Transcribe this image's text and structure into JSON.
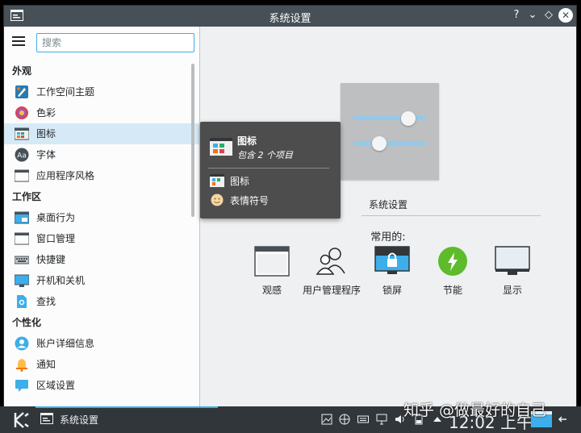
{
  "window": {
    "title": "系统设置"
  },
  "titlebar": {
    "help": "?",
    "minimize": "⌄",
    "keep_above": "◇",
    "close": "✕"
  },
  "search": {
    "placeholder": "搜索",
    "value": ""
  },
  "sidebar": {
    "sections": [
      {
        "title": "外观",
        "items": [
          {
            "label": "工作空间主题",
            "icon": "workspace-theme-icon"
          },
          {
            "label": "色彩",
            "icon": "colors-icon"
          },
          {
            "label": "图标",
            "icon": "icons-icon",
            "selected": true
          },
          {
            "label": "字体",
            "icon": "fonts-icon"
          },
          {
            "label": "应用程序风格",
            "icon": "app-style-icon"
          }
        ]
      },
      {
        "title": "工作区",
        "items": [
          {
            "label": "桌面行为",
            "icon": "desktop-behavior-icon"
          },
          {
            "label": "窗口管理",
            "icon": "window-management-icon"
          },
          {
            "label": "快捷键",
            "icon": "shortcuts-icon"
          },
          {
            "label": "开机和关机",
            "icon": "startup-shutdown-icon"
          },
          {
            "label": "查找",
            "icon": "search-file-icon"
          }
        ]
      },
      {
        "title": "个性化",
        "items": [
          {
            "label": "账户详细信息",
            "icon": "account-icon"
          },
          {
            "label": "通知",
            "icon": "notifications-icon"
          },
          {
            "label": "区域设置",
            "icon": "regional-settings-icon"
          }
        ]
      }
    ]
  },
  "tooltip": {
    "title": "图标",
    "subtitle": "包含 2 个项目",
    "items": [
      {
        "label": "图标",
        "icon": "icons-icon"
      },
      {
        "label": "表情符号",
        "icon": "emoji-icon"
      }
    ]
  },
  "main": {
    "hero_label": "系统设置",
    "frequent_title": "常用的:",
    "frequent": [
      {
        "label": "观感",
        "icon": "look-and-feel-icon"
      },
      {
        "label": "用户管理程序",
        "icon": "users-icon"
      },
      {
        "label": "锁屏",
        "icon": "lock-screen-icon"
      },
      {
        "label": "节能",
        "icon": "power-saving-icon"
      },
      {
        "label": "显示",
        "icon": "display-icon"
      }
    ]
  },
  "taskbar": {
    "task_label": "系统设置",
    "clock": "12:02 上午",
    "watermark": "知乎 @做最好的自己"
  },
  "colors": {
    "accent": "#3daee9",
    "titlebar": "#475057",
    "taskbar": "#31363b",
    "selection": "#d6e9f6"
  }
}
